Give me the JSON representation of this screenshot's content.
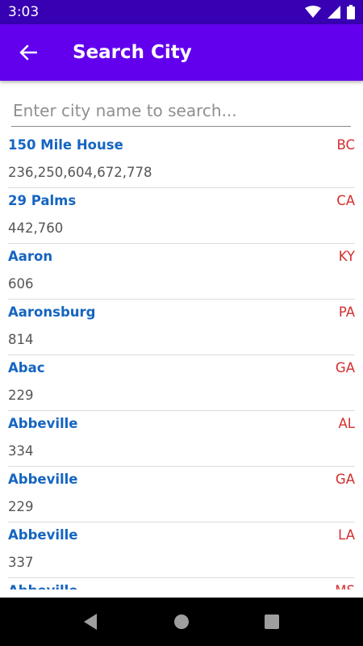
{
  "status_bar": {
    "time": "3:03",
    "icons": [
      "wifi-icon",
      "signal-icon",
      "battery-icon"
    ]
  },
  "app_bar": {
    "back_icon": "arrow-left-icon",
    "title": "Search City"
  },
  "search": {
    "value": "",
    "placeholder": "Enter city name to search..."
  },
  "cities": [
    {
      "name": "150 Mile House",
      "state": "BC",
      "codes": "236,250,604,672,778"
    },
    {
      "name": "29 Palms",
      "state": "CA",
      "codes": "442,760"
    },
    {
      "name": "Aaron",
      "state": "KY",
      "codes": "606"
    },
    {
      "name": "Aaronsburg",
      "state": "PA",
      "codes": "814"
    },
    {
      "name": "Abac",
      "state": "GA",
      "codes": "229"
    },
    {
      "name": "Abbeville",
      "state": "AL",
      "codes": "334"
    },
    {
      "name": "Abbeville",
      "state": "GA",
      "codes": "229"
    },
    {
      "name": "Abbeville",
      "state": "LA",
      "codes": "337"
    },
    {
      "name": "Abbeville",
      "state": "MS",
      "codes": ""
    }
  ],
  "nav_bar": {
    "buttons": [
      "back-triangle-icon",
      "home-circle-icon",
      "recents-square-icon"
    ]
  },
  "colors": {
    "status_bar": "#3700b3",
    "app_bar": "#6200ee",
    "city_name": "#1565c0",
    "state": "#d32f2f"
  }
}
